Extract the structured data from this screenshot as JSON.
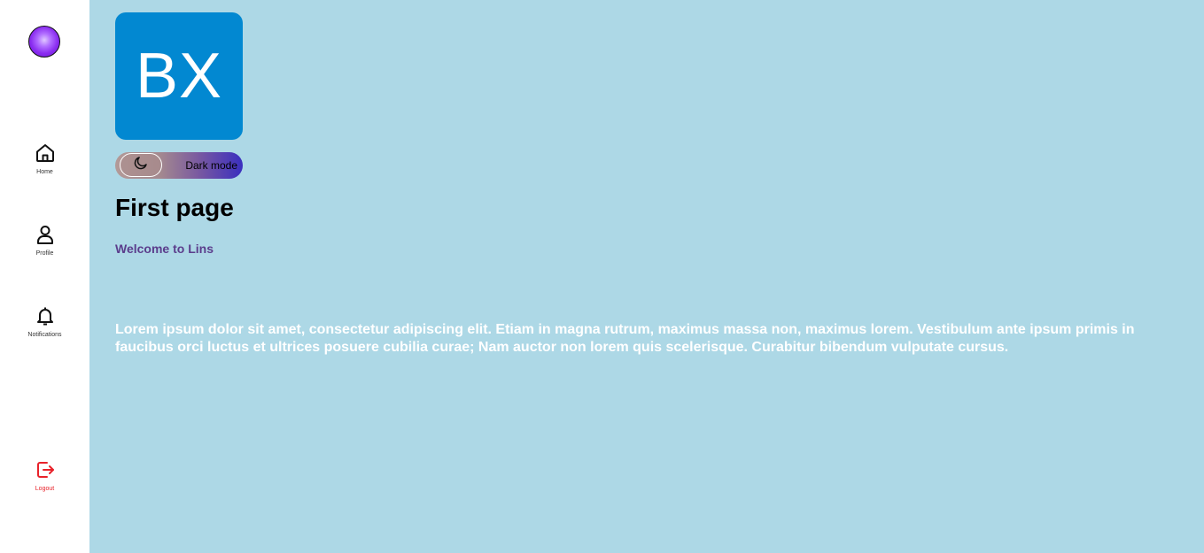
{
  "sidebar": {
    "logo_icon": "purple-orb-icon",
    "items": [
      {
        "label": "Home",
        "icon": "home-icon"
      },
      {
        "label": "Profile",
        "icon": "user-icon"
      },
      {
        "label": "Notifications",
        "icon": "bell-icon"
      }
    ],
    "logout": {
      "label": "Logout",
      "icon": "logout-icon",
      "color": "#e8222a"
    }
  },
  "main": {
    "brand_logo_text": "BX",
    "brand_logo_color": "#0288d1",
    "background_color": "#add8e6",
    "dark_mode_toggle": {
      "label": "Dark mode",
      "icon": "moon-icon",
      "enabled": false
    },
    "title": "First page",
    "welcome": "Welcome to Lins",
    "body": "Lorem ipsum dolor sit amet, consectetur adipiscing elit. Etiam in magna rutrum, maximus massa non, maximus lorem. Vestibulum ante ipsum primis in faucibus orci luctus et ultrices posuere cubilia curae; Nam auctor non lorem quis scelerisque. Curabitur bibendum vulputate cursus."
  }
}
